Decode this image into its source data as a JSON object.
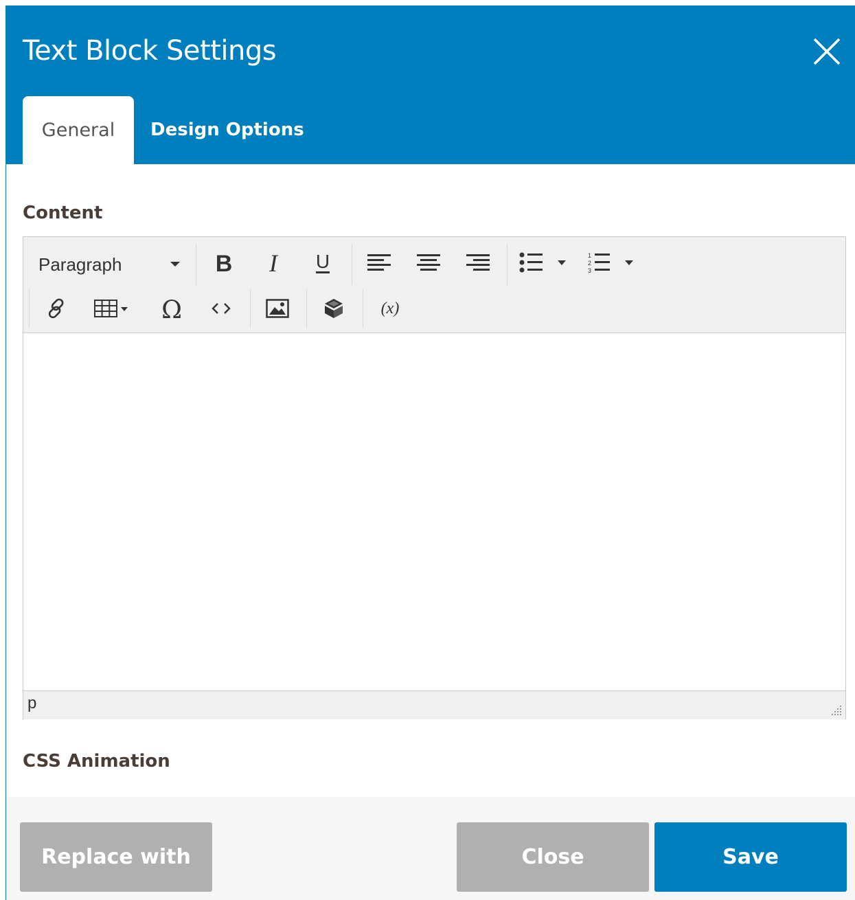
{
  "dialog": {
    "title": "Text Block Settings"
  },
  "tabs": [
    {
      "label": "General",
      "active": true
    },
    {
      "label": "Design Options",
      "active": false
    }
  ],
  "content_section": {
    "label": "Content"
  },
  "editor": {
    "format_select": "Paragraph",
    "status_path": "p",
    "toolbar_row1": [
      "bold-icon",
      "italic-icon",
      "underline-icon",
      "align-left-icon",
      "align-center-icon",
      "align-right-icon",
      "bullet-list-icon",
      "numbered-list-icon"
    ],
    "toolbar_row2": [
      "link-icon",
      "table-icon",
      "omega-icon",
      "code-icon",
      "image-icon",
      "widget-icon",
      "variable-icon"
    ]
  },
  "animation_section": {
    "label": "CSS Animation"
  },
  "footer": {
    "replace_label": "Replace with",
    "close_label": "Close",
    "save_label": "Save"
  },
  "colors": {
    "brand": "#007fbf",
    "button_gray": "#b0b0b0"
  }
}
